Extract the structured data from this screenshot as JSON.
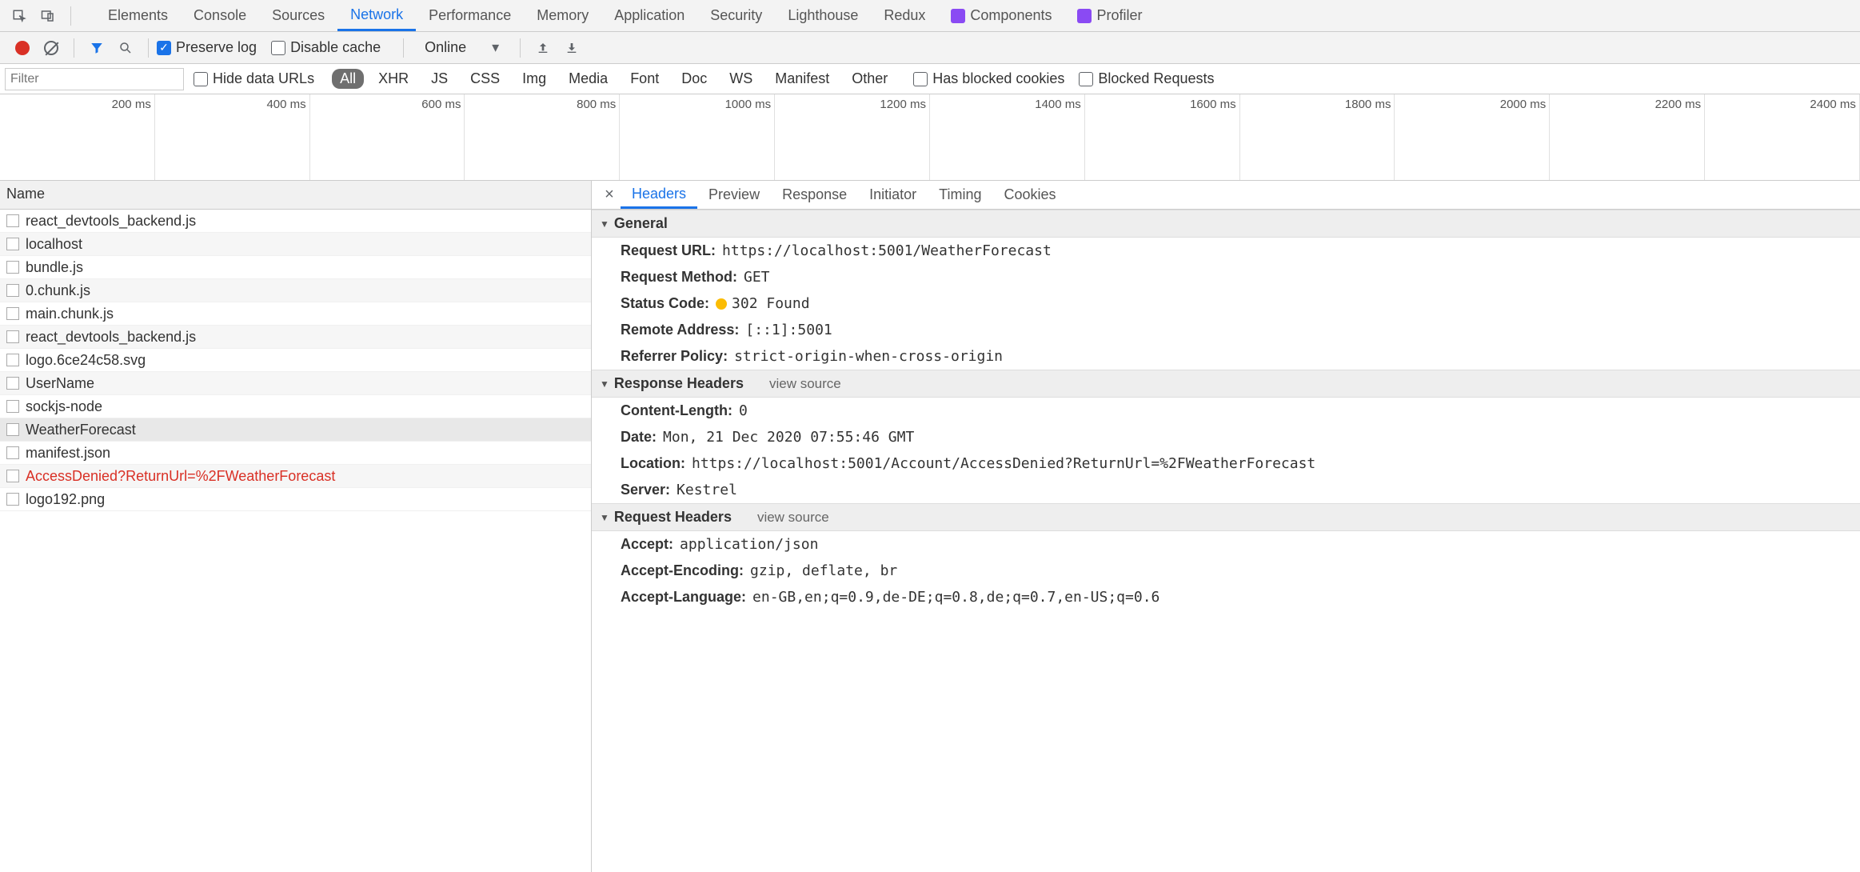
{
  "tabs": {
    "items": [
      "Elements",
      "Console",
      "Sources",
      "Network",
      "Performance",
      "Memory",
      "Application",
      "Security",
      "Lighthouse",
      "Redux",
      "Components",
      "Profiler"
    ],
    "active": "Network"
  },
  "toolbar": {
    "preserve_log_label": "Preserve log",
    "disable_cache_label": "Disable cache",
    "throttle": "Online"
  },
  "filter": {
    "placeholder": "Filter",
    "hide_data_urls": "Hide data URLs",
    "types": [
      "All",
      "XHR",
      "JS",
      "CSS",
      "Img",
      "Media",
      "Font",
      "Doc",
      "WS",
      "Manifest",
      "Other"
    ],
    "type_active": "All",
    "has_blocked_cookies": "Has blocked cookies",
    "blocked_requests": "Blocked Requests"
  },
  "timeline_labels": [
    "200 ms",
    "400 ms",
    "600 ms",
    "800 ms",
    "1000 ms",
    "1200 ms",
    "1400 ms",
    "1600 ms",
    "1800 ms",
    "2000 ms",
    "2200 ms",
    "2400 ms"
  ],
  "name_header": "Name",
  "requests": [
    {
      "name": "react_devtools_backend.js"
    },
    {
      "name": "localhost"
    },
    {
      "name": "bundle.js"
    },
    {
      "name": "0.chunk.js"
    },
    {
      "name": "main.chunk.js"
    },
    {
      "name": "react_devtools_backend.js"
    },
    {
      "name": "logo.6ce24c58.svg"
    },
    {
      "name": "UserName"
    },
    {
      "name": "sockjs-node"
    },
    {
      "name": "WeatherForecast",
      "selected": true
    },
    {
      "name": "manifest.json"
    },
    {
      "name": "AccessDenied?ReturnUrl=%2FWeatherForecast",
      "error": true
    },
    {
      "name": "logo192.png"
    }
  ],
  "detail_tabs": [
    "Headers",
    "Preview",
    "Response",
    "Initiator",
    "Timing",
    "Cookies"
  ],
  "detail_tab_active": "Headers",
  "general": {
    "title": "General",
    "request_url_k": "Request URL:",
    "request_url_v": "https://localhost:5001/WeatherForecast",
    "request_method_k": "Request Method:",
    "request_method_v": "GET",
    "status_code_k": "Status Code:",
    "status_code_v": "302 Found",
    "remote_address_k": "Remote Address:",
    "remote_address_v": "[::1]:5001",
    "referrer_policy_k": "Referrer Policy:",
    "referrer_policy_v": "strict-origin-when-cross-origin"
  },
  "response_headers": {
    "title": "Response Headers",
    "view_source": "view source",
    "items": [
      {
        "k": "Content-Length:",
        "v": "0"
      },
      {
        "k": "Date:",
        "v": "Mon, 21 Dec 2020 07:55:46 GMT"
      },
      {
        "k": "Location:",
        "v": "https://localhost:5001/Account/AccessDenied?ReturnUrl=%2FWeatherForecast"
      },
      {
        "k": "Server:",
        "v": "Kestrel"
      }
    ]
  },
  "request_headers": {
    "title": "Request Headers",
    "view_source": "view source",
    "items": [
      {
        "k": "Accept:",
        "v": "application/json"
      },
      {
        "k": "Accept-Encoding:",
        "v": "gzip, deflate, br"
      },
      {
        "k": "Accept-Language:",
        "v": "en-GB,en;q=0.9,de-DE;q=0.8,de;q=0.7,en-US;q=0.6"
      }
    ]
  }
}
